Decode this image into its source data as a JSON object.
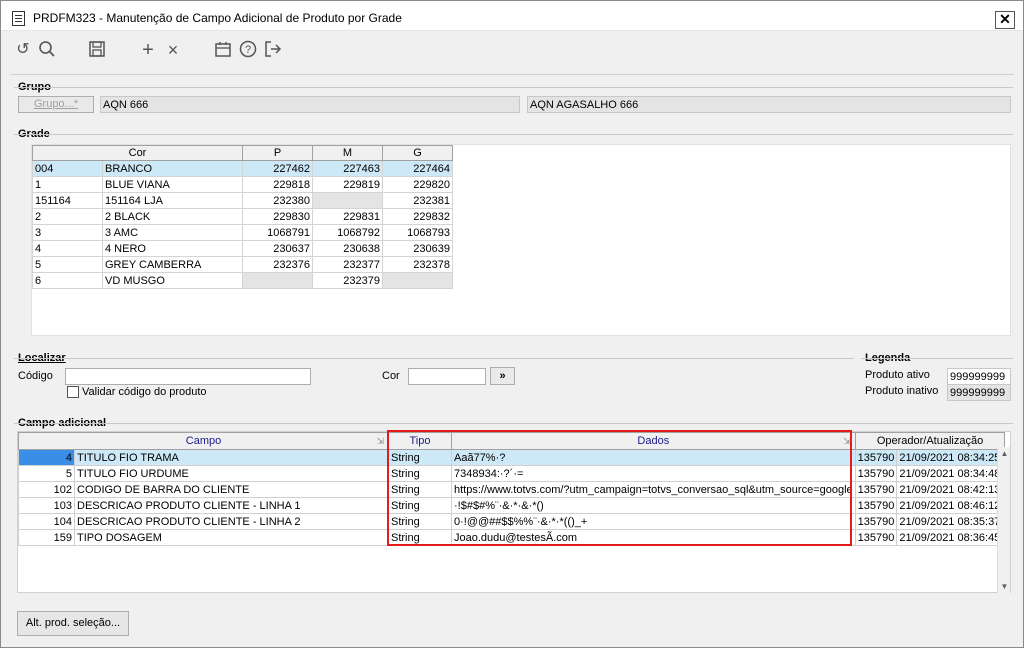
{
  "window": {
    "title": "PRDFM323 - Manutenção de Campo Adicional de Produto por Grade",
    "close_label": "✕"
  },
  "toolbar": {
    "icons": [
      "refresh-icon",
      "search-icon",
      "save-icon",
      "add-icon",
      "delete-icon",
      "calendar-icon",
      "help-icon",
      "exit-icon"
    ]
  },
  "grupo": {
    "section_label": "Grupo",
    "button_label": "Grupo...*",
    "code": "AQN 666",
    "description": "AQN AGASALHO 666"
  },
  "grade": {
    "section_label": "Grade",
    "columns": [
      "Cor",
      "P",
      "M",
      "G"
    ],
    "rows": [
      {
        "code": "004",
        "name": "BRANCO",
        "p": "227462",
        "m": "227463",
        "g": "227464"
      },
      {
        "code": "1",
        "name": "BLUE VIANA",
        "p": "229818",
        "m": "229819",
        "g": "229820"
      },
      {
        "code": "151164",
        "name": "151164 LJA",
        "p": "232380",
        "m": "",
        "g": "232381"
      },
      {
        "code": "2",
        "name": "2 BLACK",
        "p": "229830",
        "m": "229831",
        "g": "229832"
      },
      {
        "code": "3",
        "name": "3 AMC",
        "p": "1068791",
        "m": "1068792",
        "g": "1068793"
      },
      {
        "code": "4",
        "name": "4 NERO",
        "p": "230637",
        "m": "230638",
        "g": "230639"
      },
      {
        "code": "5",
        "name": "GREY CAMBERRA",
        "p": "232376",
        "m": "232377",
        "g": "232378"
      },
      {
        "code": "6",
        "name": "VD MUSGO",
        "p": "",
        "m": "232379",
        "g": ""
      }
    ]
  },
  "localizar": {
    "section_label": "Localizar",
    "codigo_label": "Código",
    "codigo_value": "",
    "cor_label": "Cor",
    "cor_value": "",
    "go_label": "»",
    "checkbox_label": "Validar código do produto"
  },
  "legenda": {
    "section_label": "Legenda",
    "ativo_label": "Produto ativo",
    "ativo_value": "999999999",
    "inativo_label": "Produto inativo",
    "inativo_value": "999999999"
  },
  "campo_adicional": {
    "section_label": "Campo adicional",
    "columns": {
      "campo": "Campo",
      "tipo": "Tipo",
      "dados": "Dados",
      "operador": "Operador/Atualização"
    },
    "rows": [
      {
        "num": "4",
        "nome": "TITULO FIO TRAMA",
        "tipo": "String",
        "dados": "Aaã77%·?",
        "operador": "135790",
        "data": "21/09/2021 08:34:25"
      },
      {
        "num": "5",
        "nome": "TITULO FIO URDUME",
        "tipo": "String",
        "dados": "7348934:·?´·=",
        "operador": "135790",
        "data": "21/09/2021 08:34:48"
      },
      {
        "num": "102",
        "nome": "CODIGO DE BARRA DO CLIENTE",
        "tipo": "String",
        "dados": "https://www.totvs.com/?utm_campaign=totvs_conversao_sql&utm_source=google",
        "operador": "135790",
        "data": "21/09/2021 08:42:13"
      },
      {
        "num": "103",
        "nome": "DESCRICAO PRODUTO CLIENTE - LINHA 1",
        "tipo": "String",
        "dados": "·!$#$#%¨·&·*·&·*()",
        "operador": "135790",
        "data": "21/09/2021 08:46:12"
      },
      {
        "num": "104",
        "nome": "DESCRICAO PRODUTO CLIENTE - LINHA 2",
        "tipo": "String",
        "dados": "0·!@@##$$%%¨·&·*·*(()_+",
        "operador": "135790",
        "data": "21/09/2021 08:35:37"
      },
      {
        "num": "159",
        "nome": "TIPO DOSAGEM",
        "tipo": "String",
        "dados": "Joao.dudu@testesÃ.com",
        "operador": "135790",
        "data": "21/09/2021 08:36:45"
      }
    ]
  },
  "footer": {
    "alt_button_label": "Alt. prod. seleção..."
  },
  "colors": {
    "selection": "#cde8f6",
    "highlight_border": "#e21b1b",
    "header_text": "#1a1a8c"
  }
}
